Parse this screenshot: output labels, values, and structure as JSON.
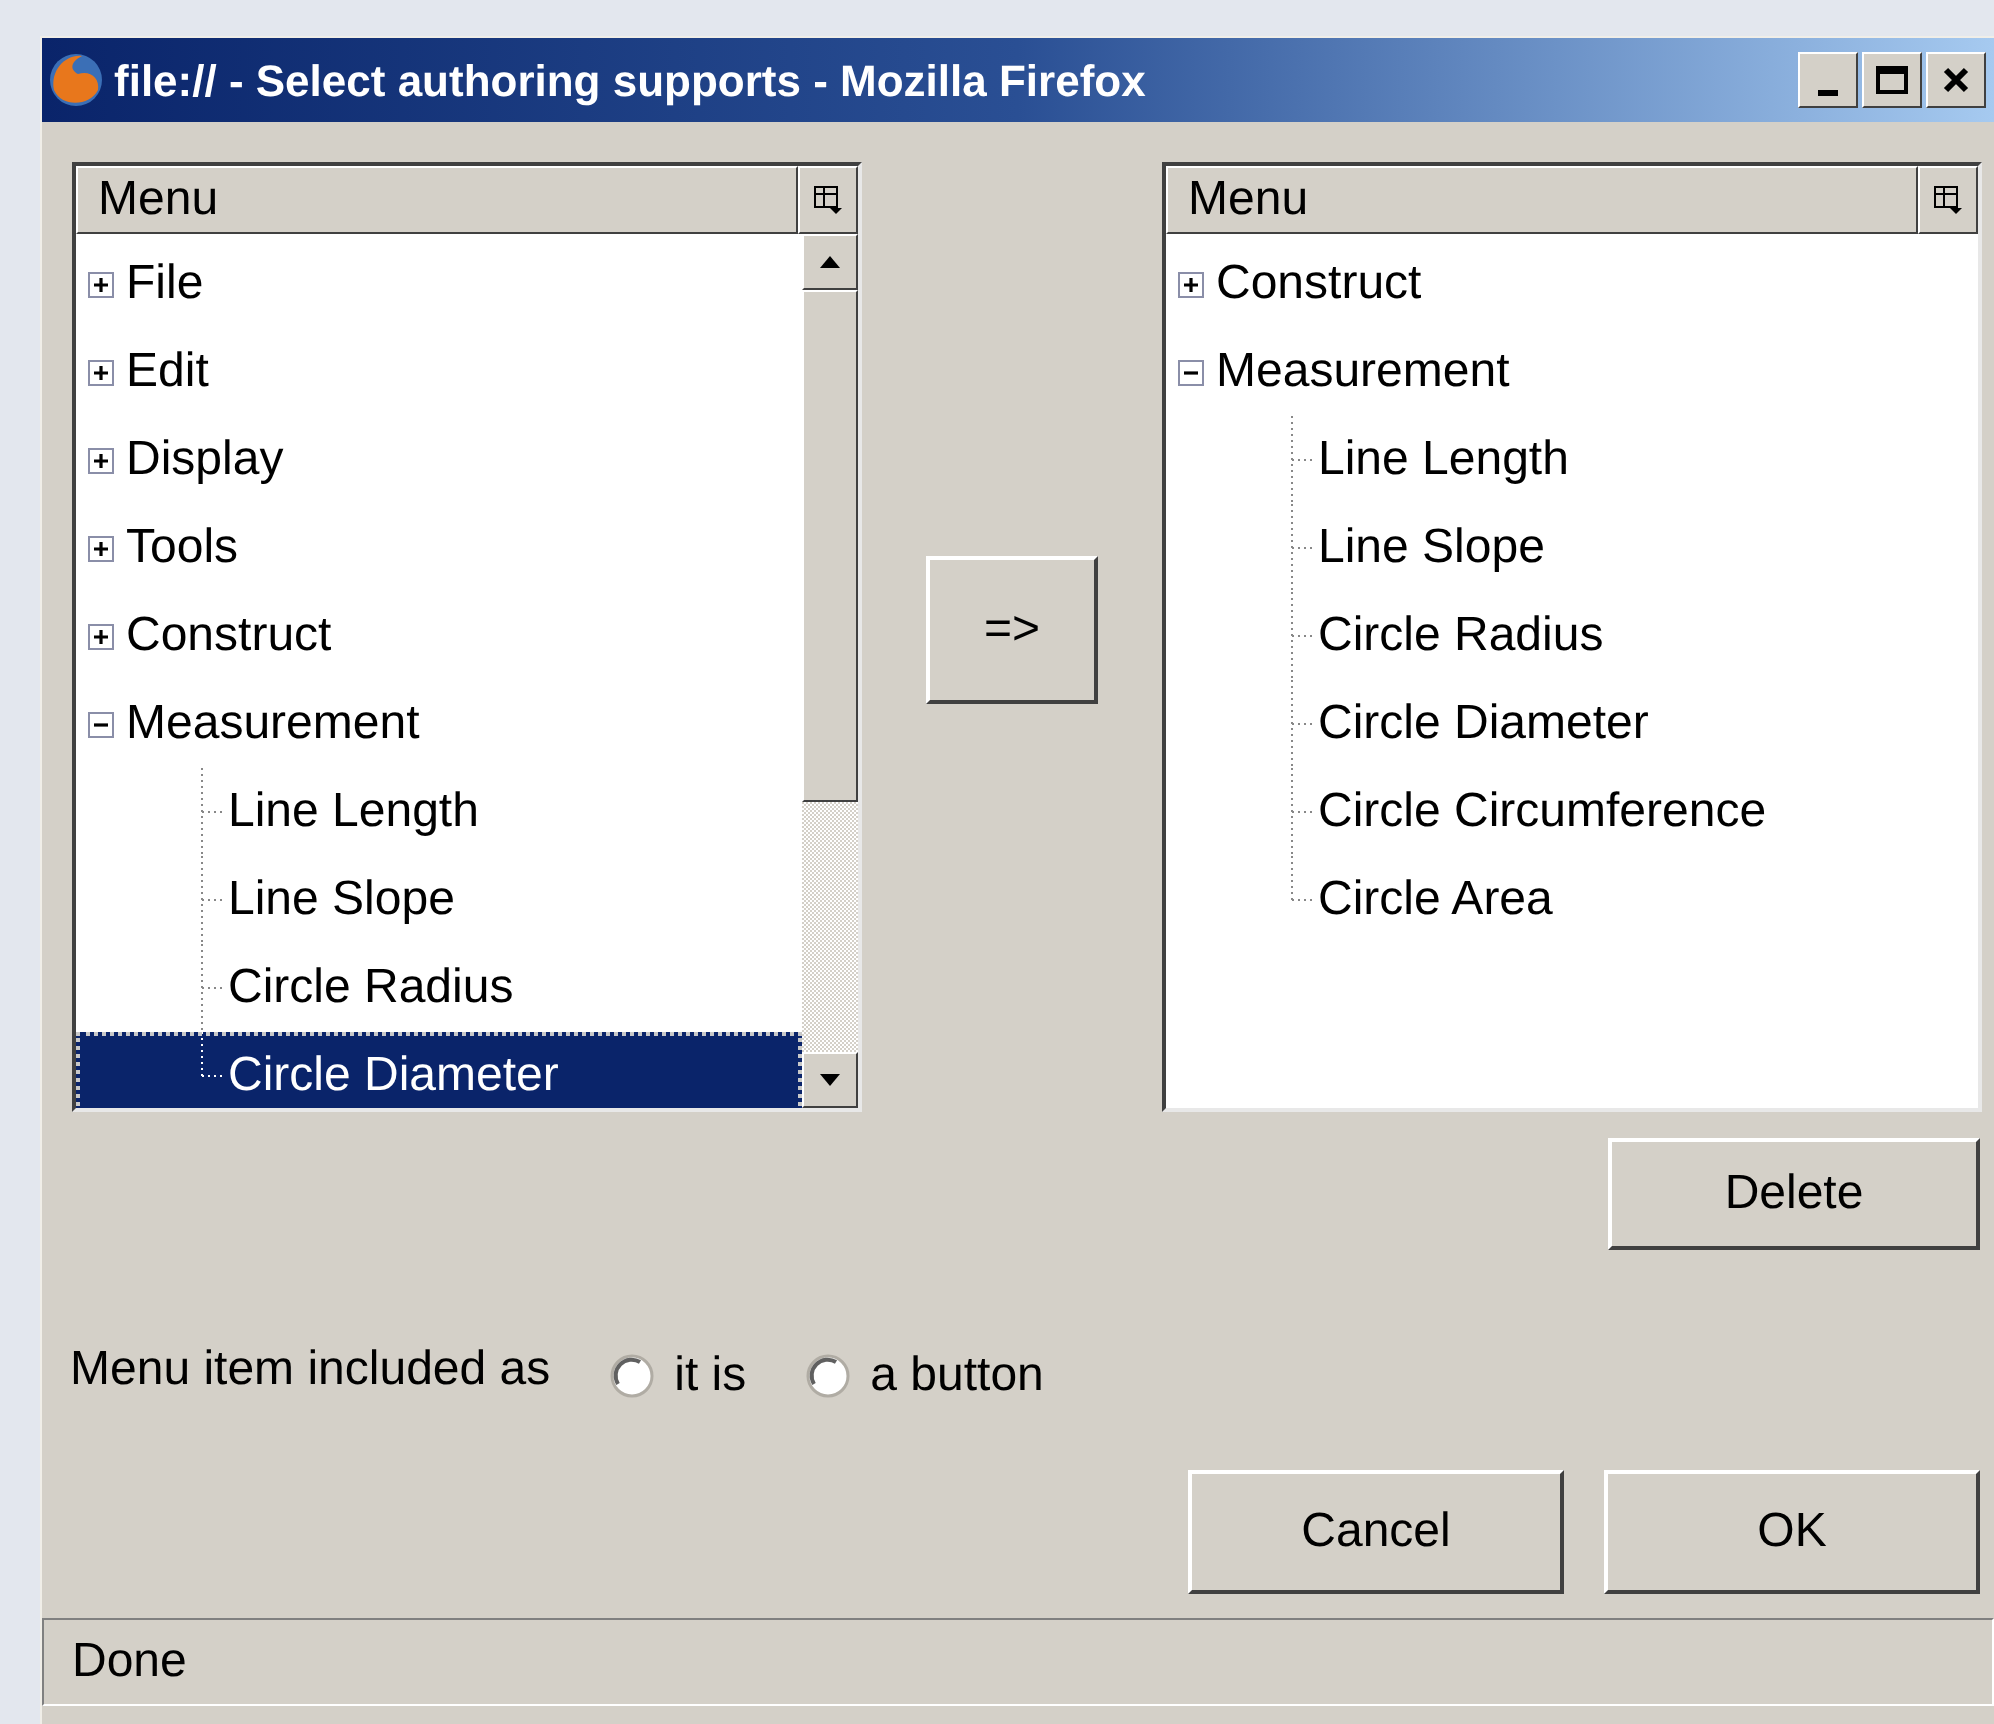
{
  "window": {
    "title": "file:// - Select authoring supports - Mozilla Firefox"
  },
  "left_tree": {
    "header": "Menu",
    "items": [
      {
        "label": "File",
        "expanded": false,
        "selected": false
      },
      {
        "label": "Edit",
        "expanded": false,
        "selected": false
      },
      {
        "label": "Display",
        "expanded": false,
        "selected": false
      },
      {
        "label": "Tools",
        "expanded": false,
        "selected": false
      },
      {
        "label": "Construct",
        "expanded": false,
        "selected": false
      },
      {
        "label": "Measurement",
        "expanded": true,
        "selected": false,
        "children": [
          {
            "label": "Line Length",
            "selected": false
          },
          {
            "label": "Line Slope",
            "selected": false
          },
          {
            "label": "Circle Radius",
            "selected": false
          },
          {
            "label": "Circle Diameter",
            "selected": true
          }
        ]
      }
    ]
  },
  "add_button": "=>",
  "right_tree": {
    "header": "Menu",
    "items": [
      {
        "label": "Construct",
        "expanded": false,
        "selected": false
      },
      {
        "label": "Measurement",
        "expanded": true,
        "selected": false,
        "children": [
          {
            "label": "Line Length",
            "selected": false
          },
          {
            "label": "Line Slope",
            "selected": false
          },
          {
            "label": "Circle Radius",
            "selected": false
          },
          {
            "label": "Circle Diameter",
            "selected": false
          },
          {
            "label": "Circle Circumference",
            "selected": false
          },
          {
            "label": "Circle Area",
            "selected": false
          }
        ]
      }
    ]
  },
  "delete_button": "Delete",
  "inclusion": {
    "label": "Menu item included as",
    "options": [
      {
        "label": "it is",
        "selected": false
      },
      {
        "label": "a button",
        "selected": false
      }
    ]
  },
  "buttons": [
    "Cancel",
    "OK"
  ],
  "status_bar": "Done"
}
